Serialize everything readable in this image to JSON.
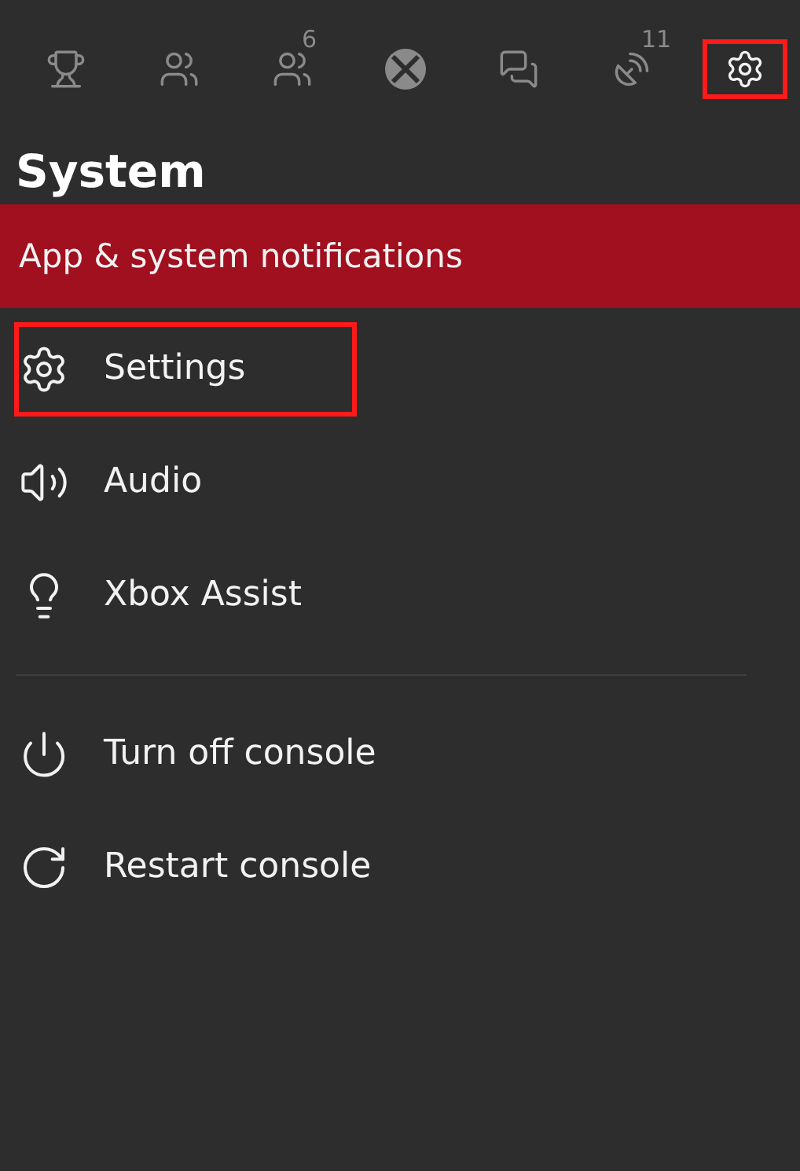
{
  "tabs": [
    {
      "selected": false,
      "highlighted": false
    },
    {
      "selected": false,
      "highlighted": false
    },
    {
      "badge": "6",
      "selected": false,
      "highlighted": false
    },
    {
      "selected": false,
      "highlighted": false
    },
    {
      "selected": false,
      "highlighted": false
    },
    {
      "badge": "11",
      "selected": false,
      "highlighted": false
    },
    {
      "selected": true,
      "highlighted": true
    }
  ],
  "title": "System",
  "groups": [
    [
      {
        "label": "App & system notifications",
        "selected": true,
        "highlighted": false
      },
      {
        "label": "Settings",
        "selected": false,
        "highlighted": true
      },
      {
        "label": "Audio",
        "selected": false,
        "highlighted": false
      },
      {
        "label": "Xbox Assist",
        "selected": false,
        "highlighted": false
      }
    ],
    [
      {
        "label": "Turn off console",
        "selected": false,
        "highlighted": false
      },
      {
        "label": "Restart console",
        "selected": false,
        "highlighted": false
      }
    ]
  ]
}
